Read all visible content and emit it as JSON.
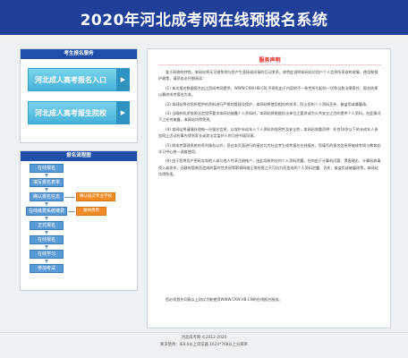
{
  "header": {
    "title": "2020年河北成考网在线预报名系统"
  },
  "service_panel": {
    "title": "考生报名服务",
    "buttons": [
      {
        "label": "河北成人高考报名入口",
        "arrow": "▶"
      },
      {
        "label": "河北成人高考报生院校",
        "arrow": "▶"
      }
    ]
  },
  "flow_panel": {
    "title": "报名流程图",
    "steps": [
      "在线报名",
      "填写报名表单",
      "确认报名信息",
      "在线缴费系统缴费",
      "正式报名",
      "在线报名",
      "在线学习",
      "参加考试"
    ],
    "notes": [
      "确认层次专业学校",
      "缴纳费用"
    ]
  },
  "statement": {
    "title": "服务声明",
    "paragraphs": [
      "鉴于网络的特性，本网站将无可避免地与您产生直接或间接的互动关系，故特此说明本网站对用户个人信息所采取的收集、使用和保护政策，请您务必仔细阅读：",
      "(1) 本次报名数据报名由江西成考网提供，WWW.CKW.HB.CN 不承担由于内容的不一致性所引起的一切争议和法律责任，报名结果以最终成考报名为准。",
      "(2) 本网站将对您所提供的资料进行严格的管理及保护，本网站将使用相应的技术，防止您的个人资料丢失、被盗用或遭篡改。",
      "(3) 当政府机关依照法定程序要求本网站披露个人资料时，本网站将根据执法单位之要求或为公共安全之目的提供个人资料。在此情况下之任何披露，本网站均得免责。",
      "(4) 本网站将谨慎处理每一份报名信息，以保护未成年人个人资料的保密性及安全性，本网站郑重声明：任何18岁以下的未成年人参加网上活动应事先得到家长或其法定监护人的可经书面同意。",
      "(5) 除成考管理系统的系列服务以外，您在本页面进行的报名均为社会考生成考报名在线报名，您填写的报名信息将被成考网与教育处学习中心统一调度使用。",
      "(6) 由于您将用户密码告知他人或与他人共享注册帐户，由此导致的任何个人资料泄露。任何由于计算机问题、黑客政击、计算机病毒侵入或发作、因政府管制而造成的暂时性关闭等影响网络正常经营之不可抗力而造成的个人资料泄露、丢失、被盗用或被篡改等，本网站均得免责。"
    ],
    "agree": "您必须首先同意以上协议才能使用WWW.CKW.HB.CN的在线报名服务。"
  },
  "footer": {
    "copyright": "河北成考网 ©2012-2020",
    "requirement": "要求使用：IE8.0以上浏览器 1024*768以上分辨率"
  }
}
